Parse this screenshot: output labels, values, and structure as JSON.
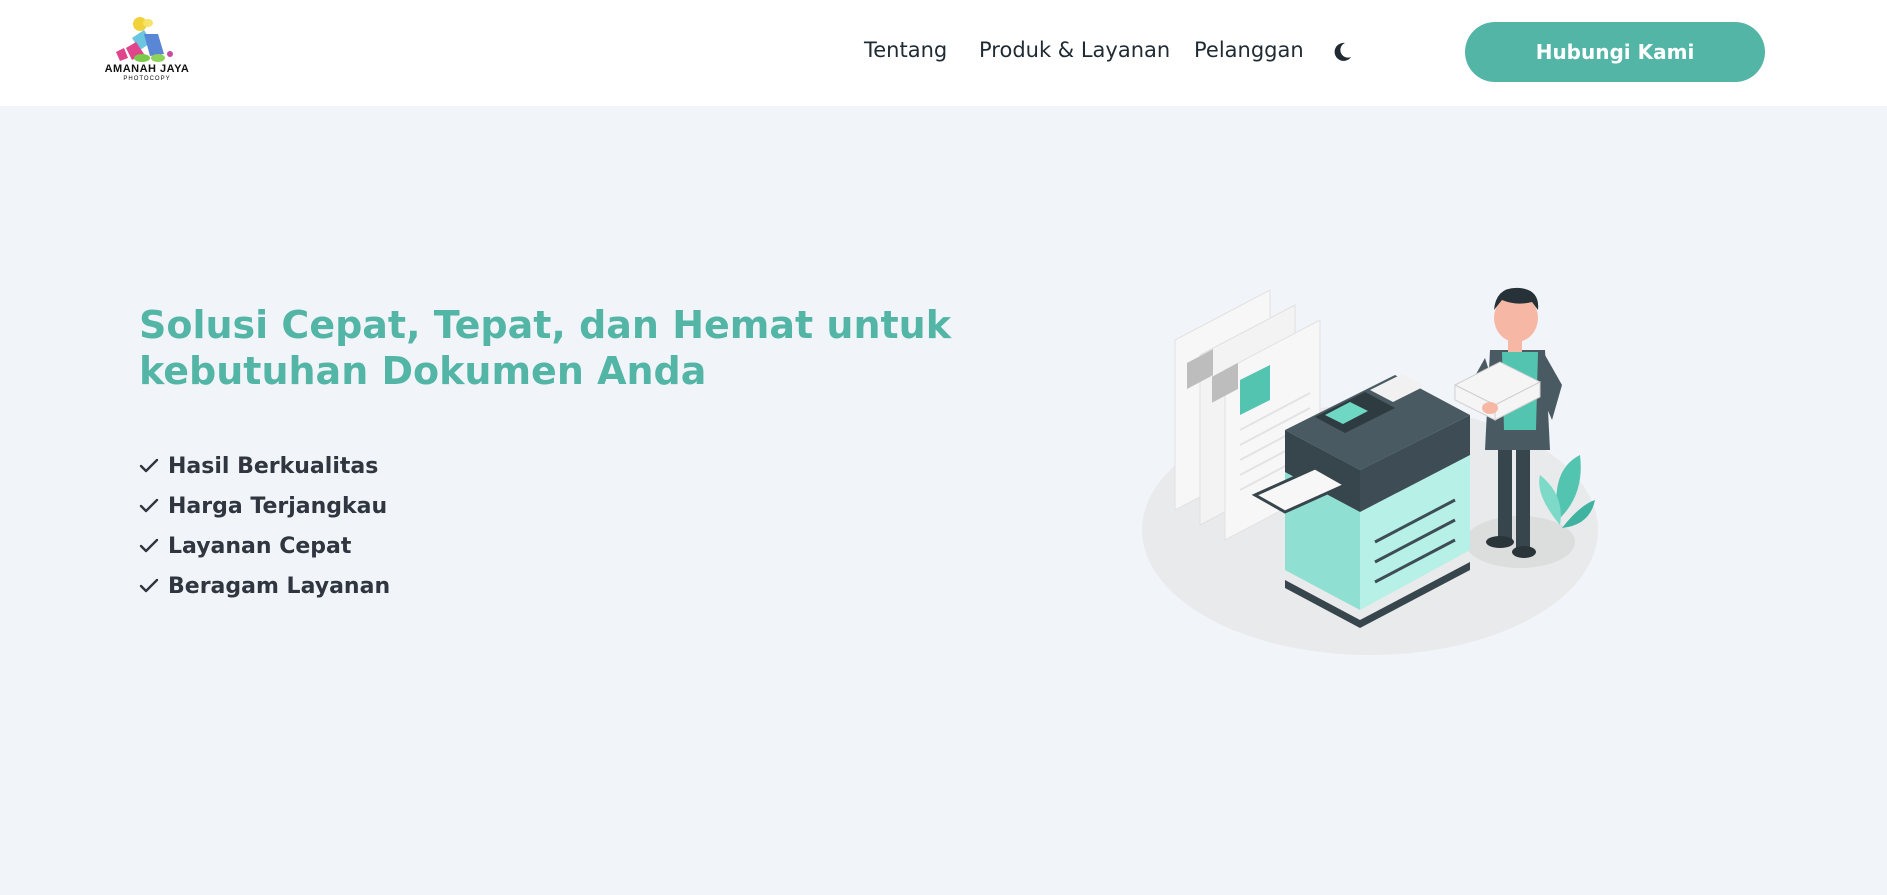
{
  "header": {
    "logo": {
      "name": "AMANAH JAYA",
      "tagline": "PHOTOCOPY"
    },
    "nav": [
      {
        "label": "Tentang"
      },
      {
        "label": "Produk & Layanan"
      },
      {
        "label": "Pelanggan"
      }
    ],
    "theme_toggle_icon": "moon-icon",
    "cta_label": "Hubungi Kami"
  },
  "hero": {
    "title_line1": "Solusi Cepat, Tepat, dan Hemat untuk",
    "title_line2": "kebutuhan Dokumen Anda",
    "features": [
      {
        "label": "Hasil Berkualitas"
      },
      {
        "label": "Harga Terjangkau"
      },
      {
        "label": "Layanan Cepat"
      },
      {
        "label": "Beragam Layanan"
      }
    ],
    "illustration_icon": "photocopier-illustration"
  },
  "colors": {
    "accent": "#52b5a6",
    "page_background": "#f1f4f8",
    "header_background": "#ffffff",
    "text_dark": "#2f3640"
  }
}
